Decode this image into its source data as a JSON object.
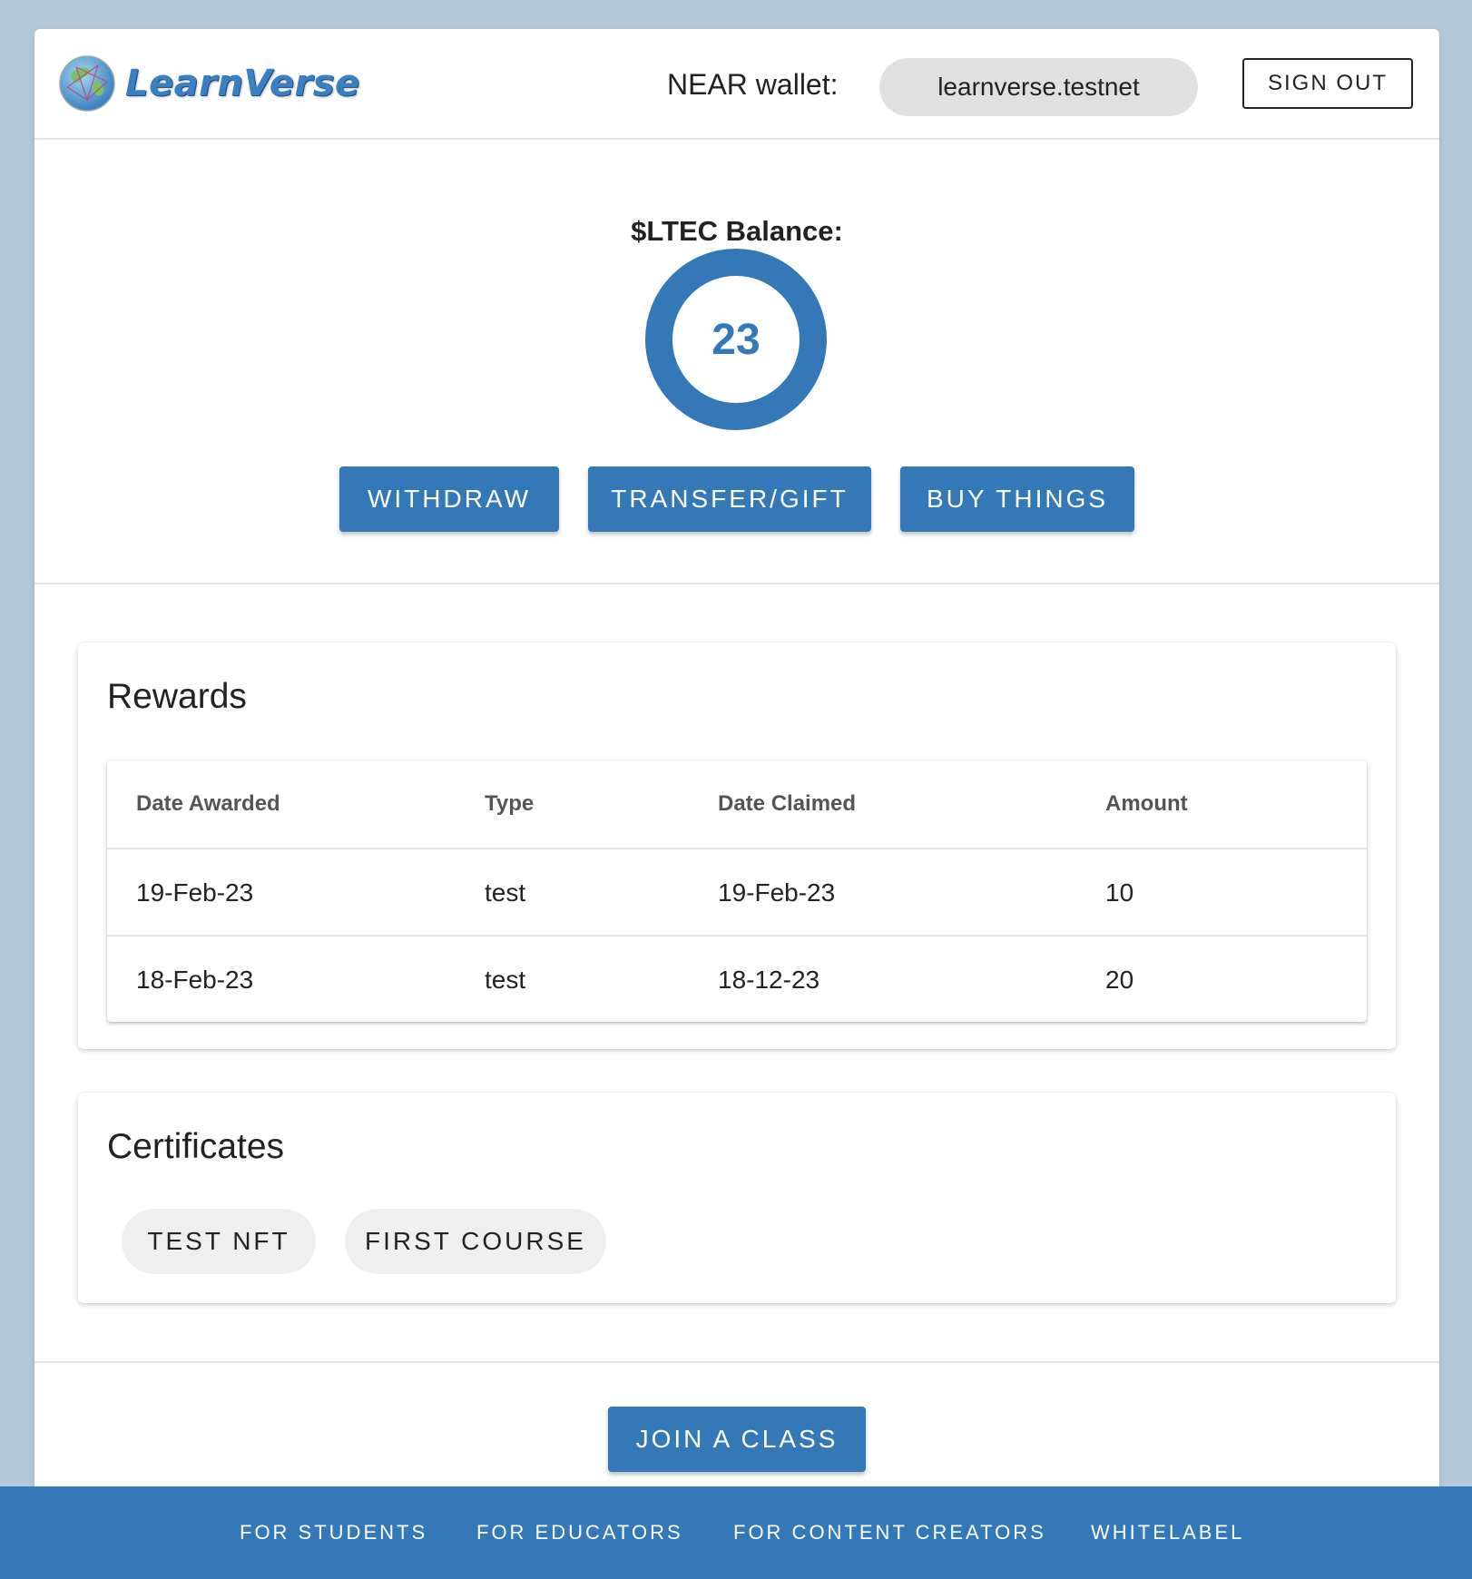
{
  "brand": {
    "name": "LearnVerse",
    "accent": "#3578b8"
  },
  "header": {
    "wallet_label": "NEAR wallet:",
    "wallet_value": "learnverse.testnet",
    "sign_out_label": "SIGN OUT"
  },
  "balance": {
    "title": "$LTEC Balance:",
    "value": "23",
    "actions": {
      "withdraw": "WITHDRAW",
      "transfer": "TRANSFER/GIFT",
      "buy": "BUY THINGS"
    }
  },
  "rewards": {
    "title": "Rewards",
    "columns": [
      "Date Awarded",
      "Type",
      "Date Claimed",
      "Amount"
    ],
    "rows": [
      [
        "19-Feb-23",
        "test",
        "19-Feb-23",
        "10"
      ],
      [
        "18-Feb-23",
        "test",
        "18-12-23",
        "20"
      ]
    ]
  },
  "certificates": {
    "title": "Certificates",
    "items": [
      "TEST NFT",
      "FIRST COURSE"
    ]
  },
  "join_class_label": "JOIN A CLASS",
  "footer": {
    "links": [
      "FOR STUDENTS",
      "FOR EDUCATORS",
      "FOR CONTENT CREATORS",
      "WHITELABEL"
    ]
  }
}
